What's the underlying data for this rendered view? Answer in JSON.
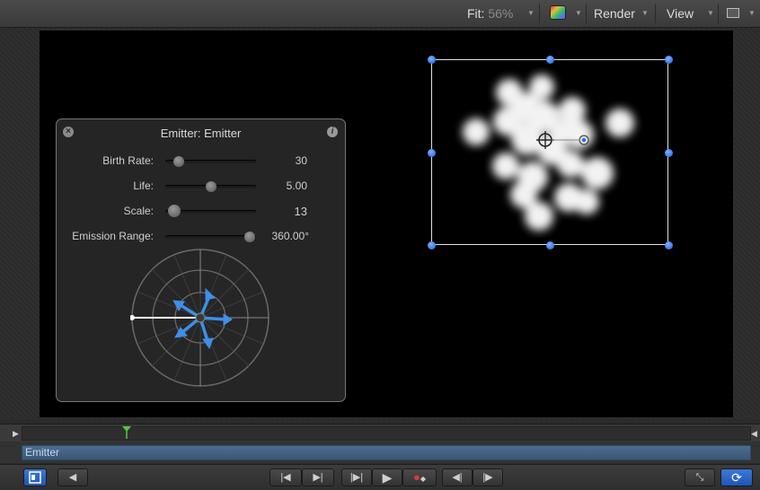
{
  "toolbar": {
    "fit_label": "Fit:",
    "fit_value": "56%",
    "render_label": "Render",
    "view_label": "View",
    "icons": [
      "color-channels-icon",
      "layout-icon"
    ]
  },
  "hud": {
    "title": "Emitter: Emitter",
    "params": [
      {
        "label": "Birth Rate:",
        "value": "30",
        "level": 0.15
      },
      {
        "label": "Life:",
        "value": "5.00",
        "level": 0.5
      },
      {
        "label": "Scale:",
        "value": "13",
        "level": 0.1
      },
      {
        "label": "Emission Range:",
        "value": "360.00°",
        "level": 0.93
      }
    ]
  },
  "timeline": {
    "layer_name": "Emitter"
  },
  "colors": {
    "accent_blue": "#2f6fe0",
    "layer_bar": "#45678c",
    "playhead_green": "#5cc04a"
  }
}
